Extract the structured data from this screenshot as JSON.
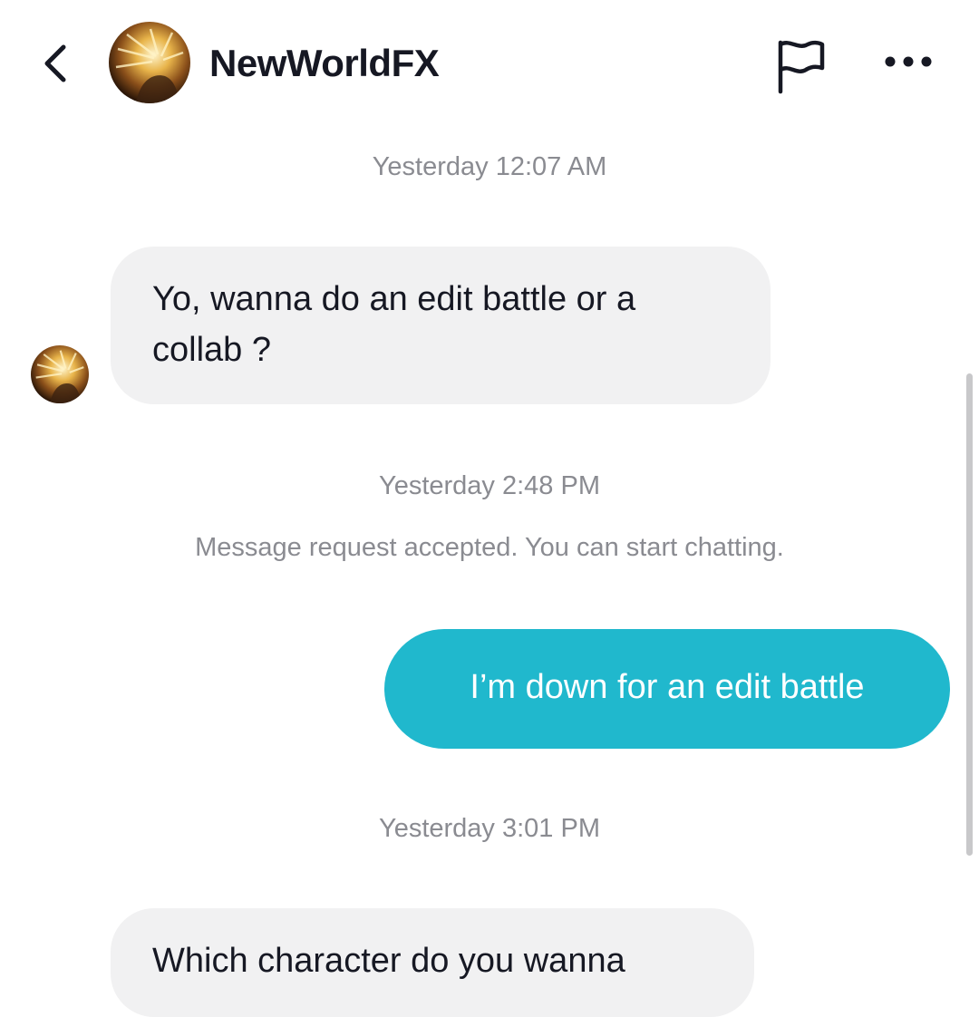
{
  "header": {
    "back_icon": "chevron-left-icon",
    "username": "NewWorldFX",
    "avatar_icon": "profile-avatar",
    "report_icon": "flag-icon",
    "more_icon": "ellipsis-icon"
  },
  "conversation": {
    "timestamp_1": "Yesterday 12:07 AM",
    "message_1": "Yo, wanna do an edit battle or a collab ?",
    "timestamp_2": "Yesterday 2:48 PM",
    "system_note": "Message request accepted. You can start chatting.",
    "message_2": "I’m down for an edit battle",
    "timestamp_3": "Yesterday 3:01 PM",
    "message_3": "Which character do you wanna"
  },
  "colors": {
    "outgoing_bubble": "#20b8cd",
    "incoming_bubble": "#f1f1f2",
    "meta_text": "#8a8b91",
    "primary_text": "#161823"
  }
}
